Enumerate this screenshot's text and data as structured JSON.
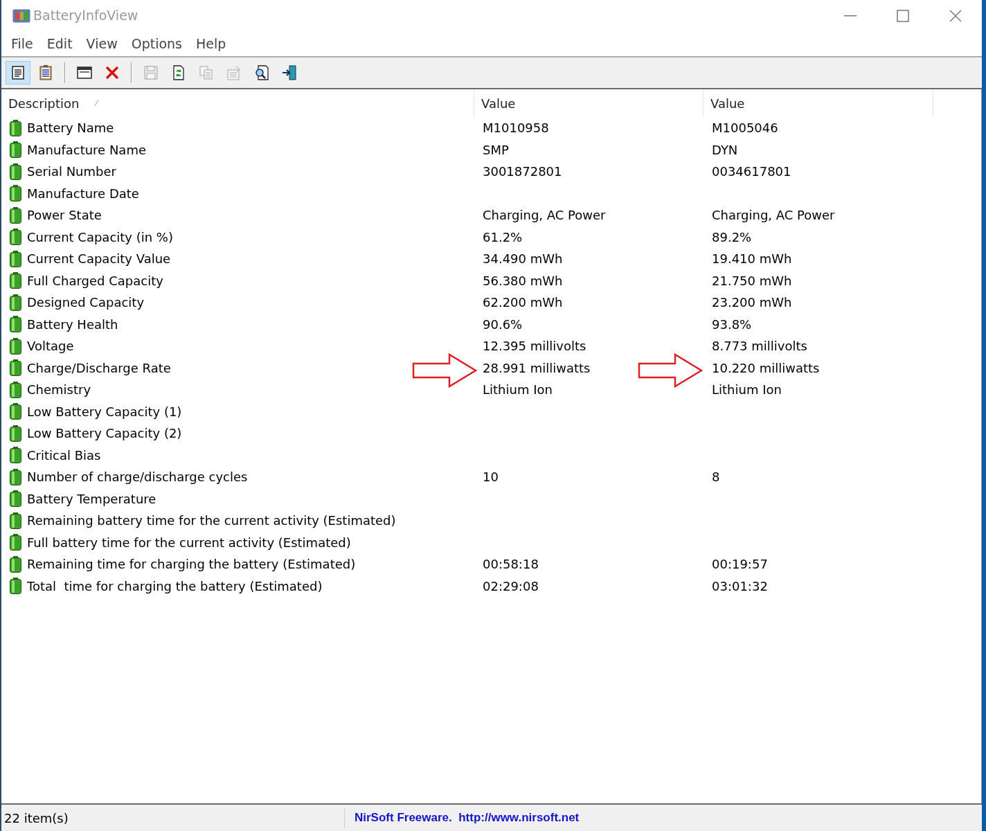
{
  "window": {
    "title": "BatteryInfoView"
  },
  "menu": [
    "File",
    "Edit",
    "View",
    "Options",
    "Help"
  ],
  "toolbar": [
    {
      "kind": "properties",
      "selected": true,
      "disabled": false
    },
    {
      "kind": "clipboard",
      "selected": false,
      "disabled": false
    },
    {
      "kind": "sep"
    },
    {
      "kind": "html",
      "selected": false,
      "disabled": false
    },
    {
      "kind": "delete",
      "selected": false,
      "disabled": false
    },
    {
      "kind": "sep"
    },
    {
      "kind": "save",
      "selected": false,
      "disabled": true
    },
    {
      "kind": "refresh",
      "selected": false,
      "disabled": false
    },
    {
      "kind": "copy",
      "selected": false,
      "disabled": true
    },
    {
      "kind": "report",
      "selected": false,
      "disabled": true
    },
    {
      "kind": "find",
      "selected": false,
      "disabled": false
    },
    {
      "kind": "exit",
      "selected": false,
      "disabled": false
    }
  ],
  "table": {
    "columns": [
      {
        "label": "Description",
        "sort_mark": "⁄"
      },
      {
        "label": "Value"
      },
      {
        "label": "Value"
      }
    ],
    "rows": [
      {
        "cells": [
          "Battery Name",
          "M1010958",
          "M1005046"
        ],
        "arrowed": false
      },
      {
        "cells": [
          "Manufacture Name",
          "SMP",
          "DYN"
        ],
        "arrowed": false
      },
      {
        "cells": [
          "Serial Number",
          "3001872801",
          "0034617801"
        ],
        "arrowed": false
      },
      {
        "cells": [
          "Manufacture Date"
        ],
        "arrowed": false
      },
      {
        "cells": [
          "Power State",
          "Charging, AC Power",
          "Charging, AC Power"
        ],
        "arrowed": false
      },
      {
        "cells": [
          "Current Capacity (in %)",
          "61.2%",
          "89.2%"
        ],
        "arrowed": false
      },
      {
        "cells": [
          "Current Capacity Value",
          "34.490 mWh",
          "19.410 mWh"
        ],
        "arrowed": false
      },
      {
        "cells": [
          "Full Charged Capacity",
          "56.380 mWh",
          "21.750 mWh"
        ],
        "arrowed": false
      },
      {
        "cells": [
          "Designed Capacity",
          "62.200 mWh",
          "23.200 mWh"
        ],
        "arrowed": false
      },
      {
        "cells": [
          "Battery Health",
          "90.6%",
          "93.8%"
        ],
        "arrowed": false
      },
      {
        "cells": [
          "Voltage",
          "12.395 millivolts",
          "8.773 millivolts"
        ],
        "arrowed": false
      },
      {
        "cells": [
          "Charge/Discharge Rate",
          "28.991 milliwatts",
          "10.220 milliwatts"
        ],
        "arrowed": true
      },
      {
        "cells": [
          "Chemistry",
          "Lithium Ion",
          "Lithium Ion"
        ],
        "arrowed": false
      },
      {
        "cells": [
          "Low Battery Capacity (1)"
        ],
        "arrowed": false
      },
      {
        "cells": [
          "Low Battery Capacity (2)"
        ],
        "arrowed": false
      },
      {
        "cells": [
          "Critical Bias"
        ],
        "arrowed": false
      },
      {
        "cells": [
          "Number of charge/discharge cycles",
          "10",
          "8"
        ],
        "arrowed": false
      },
      {
        "cells": [
          "Battery Temperature"
        ],
        "arrowed": false
      },
      {
        "cells": [
          "Remaining battery time for the current activity (Estimated)"
        ],
        "arrowed": false
      },
      {
        "cells": [
          "Full battery time for the current activity (Estimated)"
        ],
        "arrowed": false
      },
      {
        "cells": [
          "Remaining time for charging the battery (Estimated)",
          "00:58:18",
          "00:19:57"
        ],
        "arrowed": false
      },
      {
        "cells": [
          "Total  time for charging the battery (Estimated)",
          "02:29:08",
          "03:01:32"
        ],
        "arrowed": false
      }
    ]
  },
  "status_bar": {
    "count": "22 item(s)",
    "credit": "NirSoft Freeware.  http://www.nirsoft.net"
  }
}
